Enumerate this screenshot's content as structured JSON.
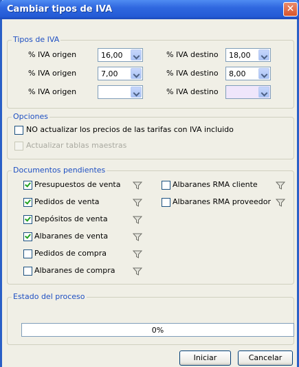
{
  "window": {
    "title": "Cambiar tipos de IVA",
    "close_glyph": "✕"
  },
  "tipos_iva": {
    "legend": "Tipos de IVA",
    "rows": [
      {
        "origen_label": "% IVA origen",
        "origen_value": "16,00",
        "destino_label": "% IVA destino",
        "destino_value": "18,00"
      },
      {
        "origen_label": "% IVA origen",
        "origen_value": "7,00",
        "destino_label": "% IVA destino",
        "destino_value": "8,00"
      },
      {
        "origen_label": "% IVA origen",
        "origen_value": "",
        "destino_label": "% IVA destino",
        "destino_value": ""
      }
    ]
  },
  "opciones": {
    "legend": "Opciones",
    "no_actualizar": {
      "label": "NO actualizar los precios de las tarifas con IVA incluido",
      "checked": false
    },
    "actualizar_maestras": {
      "label": "Actualizar tablas maestras",
      "checked": false,
      "enabled": false
    }
  },
  "documentos": {
    "legend": "Documentos pendientes",
    "left": [
      {
        "label": "Presupuestos de venta",
        "checked": true
      },
      {
        "label": "Pedidos de venta",
        "checked": true
      },
      {
        "label": "Depósitos de venta",
        "checked": true
      },
      {
        "label": "Albaranes de venta",
        "checked": true
      },
      {
        "label": "Pedidos de compra",
        "checked": false
      },
      {
        "label": "Albaranes de compra",
        "checked": false
      }
    ],
    "right": [
      {
        "label": "Albaranes RMA cliente",
        "checked": false
      },
      {
        "label": "Albaranes RMA proveedor",
        "checked": false
      }
    ],
    "filter_icon": "filter-funnel-icon"
  },
  "estado": {
    "legend": "Estado del proceso",
    "progress_text": "0%",
    "progress_fraction": 0
  },
  "buttons": {
    "iniciar": "Iniciar",
    "cancelar": "Cancelar"
  },
  "colors": {
    "title_bar": "#245bd6",
    "legend": "#1e4fc2",
    "check": "#21a121"
  }
}
